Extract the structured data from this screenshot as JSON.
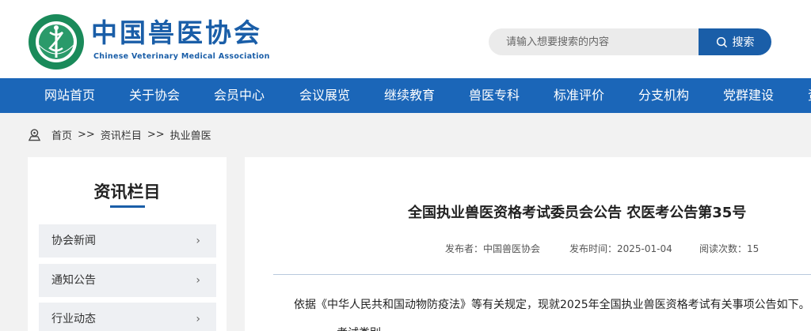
{
  "header": {
    "logo_cn": "中国兽医协会",
    "logo_en": "Chinese Veterinary Medical Association",
    "search_placeholder": "请输入想要搜索的内容",
    "search_button": "搜索"
  },
  "nav": {
    "items": [
      "网站首页",
      "关于协会",
      "会员中心",
      "会议展览",
      "继续教育",
      "兽医专科",
      "标准评价",
      "分支机构",
      "党群建设",
      "资"
    ]
  },
  "breadcrumb": {
    "home": "首页",
    "sep": ">>",
    "level1": "资讯栏目",
    "level2": "执业兽医"
  },
  "sidebar": {
    "title": "资讯栏目",
    "items": [
      {
        "label": "协会新闻"
      },
      {
        "label": "通知公告"
      },
      {
        "label": "行业动态"
      }
    ]
  },
  "article": {
    "title": "全国执业兽医资格考试委员会公告 农医考公告第35号",
    "publisher_label": "发布者：",
    "publisher": "中国兽医协会",
    "time_label": "发布时间：",
    "time": "2025-01-04",
    "reads_label": "阅读次数：",
    "reads": "15",
    "body": "依据《中华人民共和国动物防疫法》等有关规定，现就2025年全国执业兽医资格考试有关事项公告如下。",
    "body2": "一、考试类别"
  },
  "colors": {
    "brand_blue": "#1a5ea8",
    "nav_blue": "#1b66b8"
  }
}
